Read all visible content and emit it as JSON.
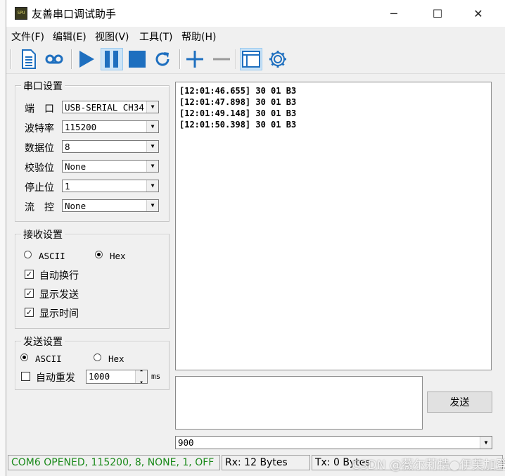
{
  "window": {
    "title": "友善串口调试助手",
    "app_icon_text": "SPU",
    "controls": {
      "minimize": "─",
      "maximize": "☐",
      "close": "✕"
    }
  },
  "menu": {
    "items": [
      "文件(F)",
      "编辑(E)",
      "视图(V)",
      "工具(T)",
      "帮助(H)"
    ]
  },
  "toolbar": {
    "icons": [
      "document-icon",
      "loop-icon",
      "play-icon",
      "pause-icon",
      "stop-icon",
      "refresh-icon",
      "add-icon",
      "remove-icon",
      "window-icon",
      "gear-icon"
    ],
    "accent": "#1e6fbf"
  },
  "serial_settings": {
    "title": "串口设置",
    "fields": [
      {
        "label": "端　口",
        "value": "USB-SERIAL CH34"
      },
      {
        "label": "波特率",
        "value": "115200"
      },
      {
        "label": "数据位",
        "value": "8"
      },
      {
        "label": "校验位",
        "value": "None"
      },
      {
        "label": "停止位",
        "value": "1"
      },
      {
        "label": "流　控",
        "value": "None"
      }
    ]
  },
  "receive_settings": {
    "title": "接收设置",
    "ascii_label": "ASCII",
    "hex_label": "Hex",
    "selected": "Hex",
    "auto_wrap": "自动换行",
    "show_send": "显示发送",
    "show_time": "显示时间"
  },
  "send_settings": {
    "title": "发送设置",
    "ascii_label": "ASCII",
    "hex_label": "Hex",
    "selected": "ASCII",
    "auto_resend": "自动重发",
    "interval": "1000",
    "unit": "ms"
  },
  "receive_log": [
    "[12:01:46.655] 30 01 B3",
    "[12:01:47.898] 30 01 B3",
    "[12:01:49.148] 30 01 B3",
    "[12:01:50.398] 30 01 B3"
  ],
  "send": {
    "button": "发送",
    "history_value": "900"
  },
  "status": {
    "connection": "COM6 OPENED, 115200, 8, NONE, 1, OFF",
    "rx": "Rx: 12 Bytes",
    "tx": "Tx: 0 Bytes",
    "connection_color": "#1a8a1a"
  },
  "watermark": "CSDN @薇尔莉特●伊芙加登"
}
